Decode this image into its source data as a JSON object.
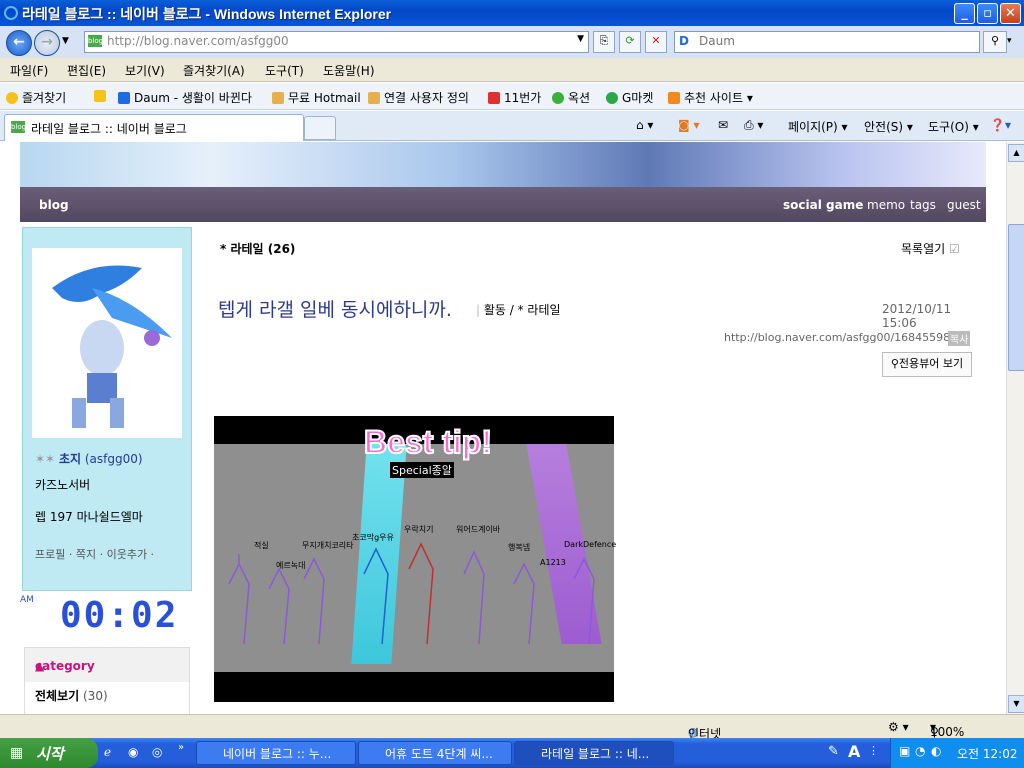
{
  "window": {
    "title": "라테일 블로그 :: 네이버 블로그 - Windows Internet Explorer"
  },
  "address": {
    "url": "http://blog.naver.com/asfgg00"
  },
  "search": {
    "placeholder": "Daum"
  },
  "menu": [
    "파일(F)",
    "편집(E)",
    "보기(V)",
    "즐겨찾기(A)",
    "도구(T)",
    "도움말(H)"
  ],
  "favorites": {
    "label": "즐겨찾기",
    "items": [
      "Daum - 생활이 바뀐다",
      "무료 Hotmail",
      "연결 사용자 정의",
      "11번가",
      "옥션",
      "G마켓",
      "추천 사이트 ▾"
    ]
  },
  "tab": {
    "label": "라테일 블로그 :: 네이버 블로그"
  },
  "commands": {
    "page": "페이지(P) ▾",
    "safety": "안전(S) ▾",
    "tools": "도구(O) ▾"
  },
  "blog": {
    "nav_label": "blog",
    "nav": [
      "social game",
      "memo",
      "tags",
      "guest"
    ],
    "profile": {
      "name": "초지",
      "id": "(asfgg00)",
      "line1": "카즈노서버",
      "line2": "렙 197 마나쉴드엘마",
      "links": "프로필 · 쪽지 · 이웃추가 ·"
    },
    "clock": {
      "ampm": "AM",
      "time": "00:02"
    },
    "category": {
      "title": "category",
      "all_label": "전체보기",
      "all_count": "(30)"
    },
    "post": {
      "category_header": "* 라테일 (26)",
      "list_toggle": "목록열기",
      "title": "텝게 라갤 일베 동시에하니까.",
      "category_path": "활동 / * 라테일",
      "date": "2012/10/11 15:06",
      "url": "http://blog.naver.com/asfgg00/168455985",
      "copy_label": "복사",
      "viewer_label": "전용뷰어 보기",
      "image": {
        "headline": "Best tip!",
        "sub": "Special종알",
        "labels": [
          "적실",
          "예르녹대",
          "무지개치코리타",
          "초코막g우유",
          "우락치기",
          "워어드계이바",
          "행복넴",
          "A1213",
          "DarkDefence"
        ]
      }
    }
  },
  "status": {
    "zone": "인터넷",
    "zoom": "100%"
  },
  "taskbar": {
    "start": "시작",
    "buttons": [
      "네이버 블로그 :: 누...",
      "어휴 도트 4단계 씨...",
      "라테일 블로그 :: 네..."
    ],
    "time": "오전 12:02"
  }
}
